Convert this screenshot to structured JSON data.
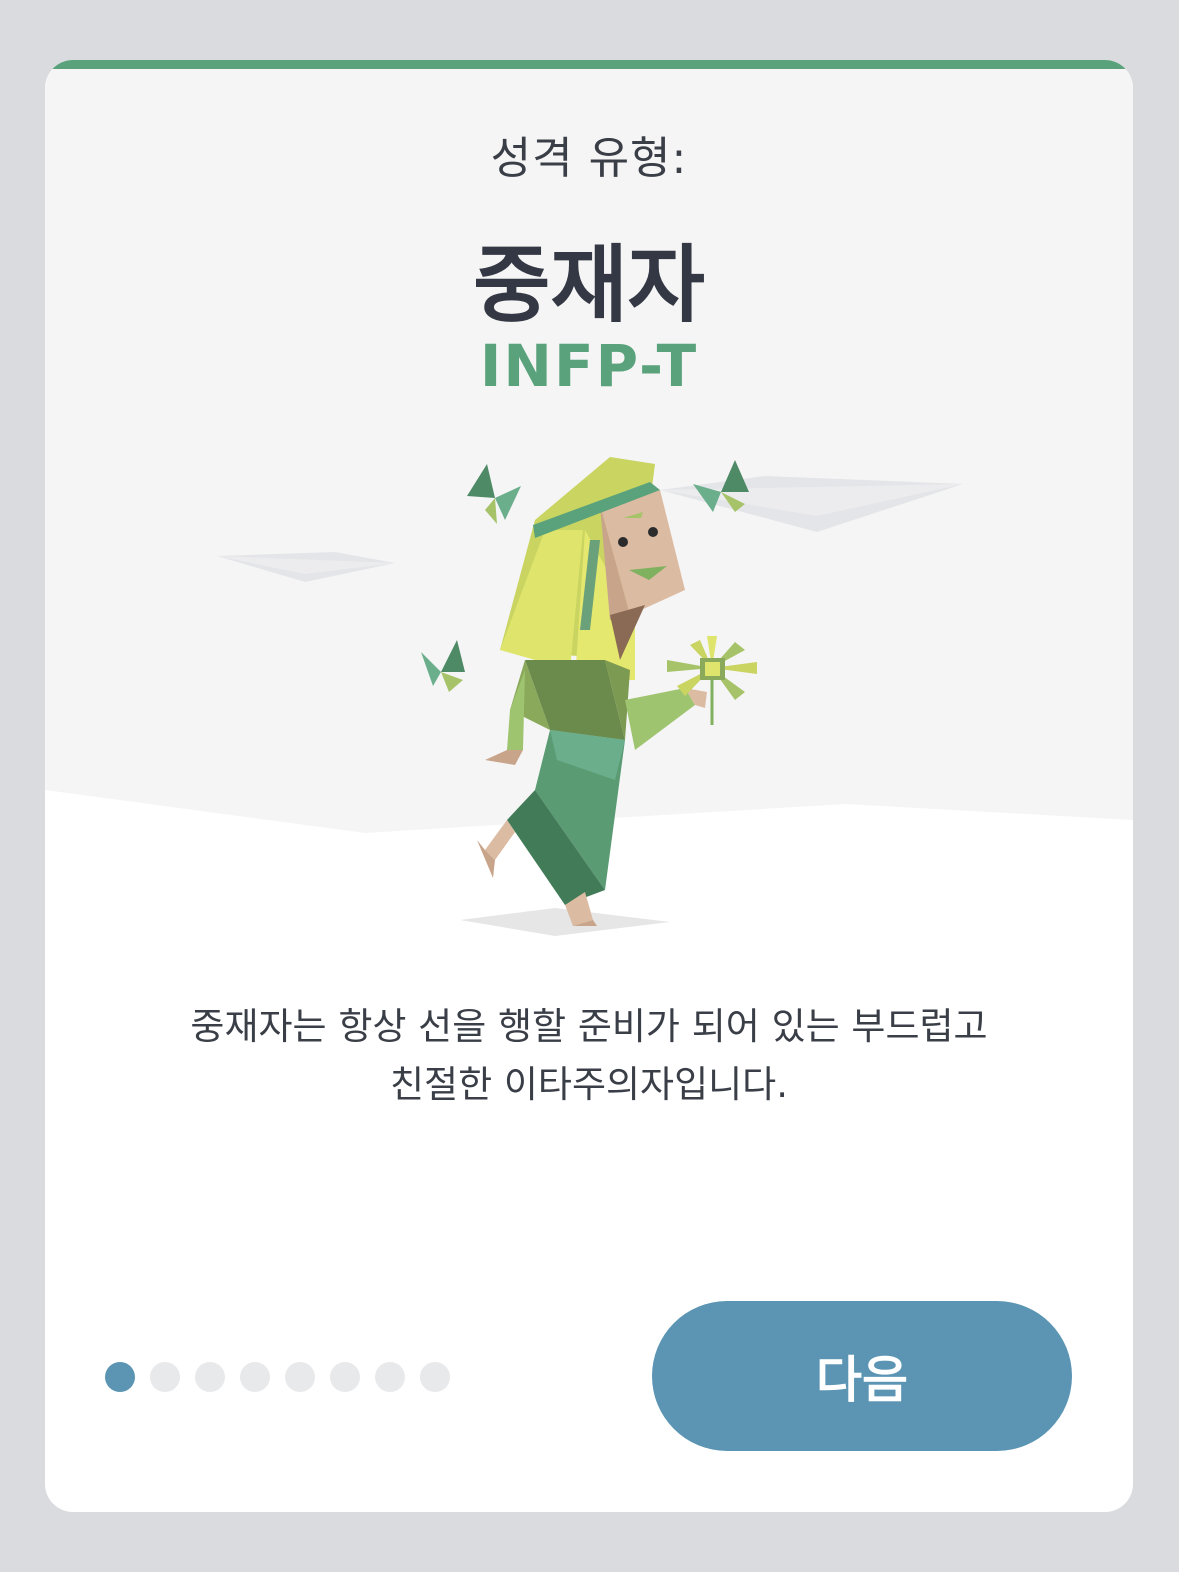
{
  "colors": {
    "accent": "#5aa27c",
    "button": "#5b95b3",
    "title": "#343844",
    "code": "#5aa27c",
    "dot_inactive": "#e8e9eb",
    "dot_active": "#5b95b3"
  },
  "header": {
    "subtitle": "성격 유형:",
    "title": "중재자",
    "code": "INFP-T"
  },
  "illustration": {
    "name": "mediator-figure-illustration"
  },
  "description": {
    "line1": "중재자는 항상 선을 행할 준비가 되어 있는 부드럽고",
    "line2": "친절한 이타주의자입니다."
  },
  "pager": {
    "total": 8,
    "current": 1
  },
  "actions": {
    "next_label": "다음"
  }
}
